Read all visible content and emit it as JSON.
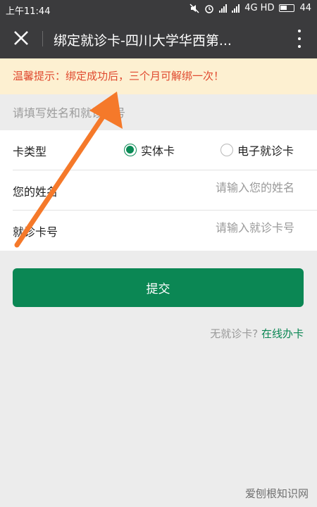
{
  "status_bar": {
    "time": "上午11:44",
    "network": "4G HD",
    "battery": "44"
  },
  "header": {
    "title": "绑定就诊卡-四川大学华西第..."
  },
  "notice": {
    "text": "温馨提示：绑定成功后，三个月可解绑一次！"
  },
  "form": {
    "section_hint": "请填写姓名和就诊卡号",
    "card_type": {
      "label": "卡类型",
      "options": [
        "实体卡",
        "电子就诊卡"
      ],
      "selected": "实体卡"
    },
    "name": {
      "label": "您的姓名",
      "placeholder": "请输入您的姓名",
      "value": ""
    },
    "card_number": {
      "label": "就诊卡号",
      "placeholder": "请输入就诊卡号",
      "value": ""
    }
  },
  "submit": {
    "label": "提交"
  },
  "no_card": {
    "text": "无就诊卡?",
    "link": "在线办卡"
  },
  "watermark": {
    "text": "爱刨根知识网"
  },
  "colors": {
    "accent": "#0b8754",
    "header_bg": "#3b3b3d",
    "notice_bg": "#fdf0d1",
    "notice_text": "#e04a2f",
    "annotation_arrow": "#f5792a"
  }
}
